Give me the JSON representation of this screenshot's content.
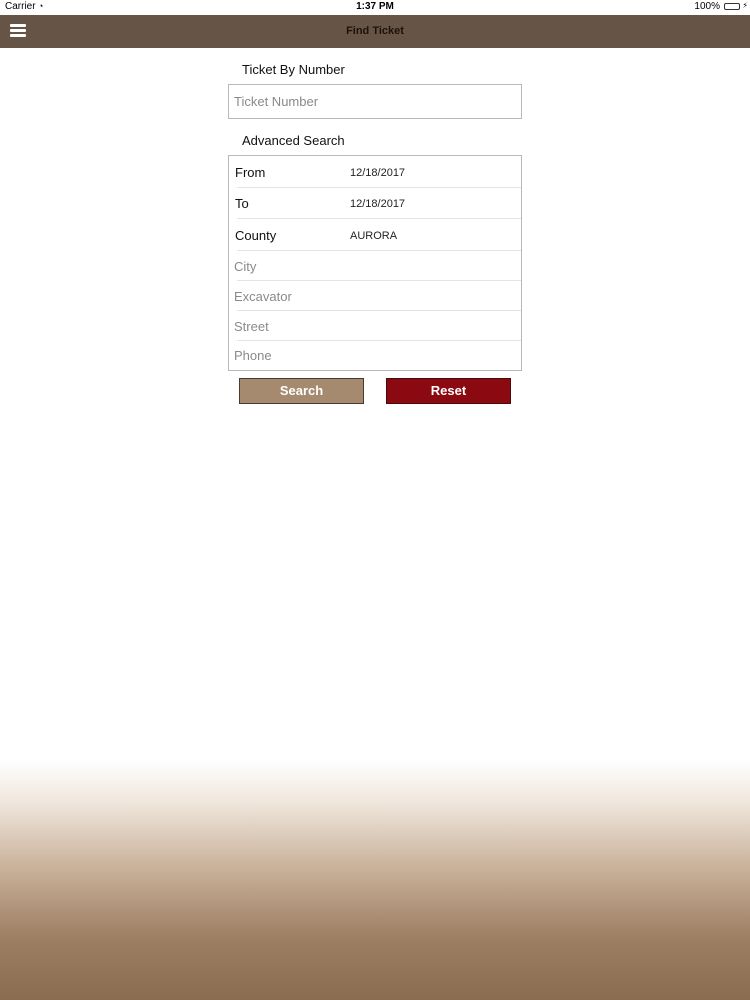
{
  "status_bar": {
    "carrier": "Carrier",
    "time": "1:37 PM",
    "battery": "100%"
  },
  "nav": {
    "title": "Find Ticket"
  },
  "ticket_by_number": {
    "heading": "Ticket By Number",
    "placeholder": "Ticket Number"
  },
  "advanced_search": {
    "heading": "Advanced Search",
    "from": {
      "label": "From",
      "value": "12/18/2017"
    },
    "to": {
      "label": "To",
      "value": "12/18/2017"
    },
    "county": {
      "label": "County",
      "value": "AURORA"
    },
    "city_placeholder": "City",
    "excavator_placeholder": "Excavator",
    "street_placeholder": "Street",
    "phone_placeholder": "Phone"
  },
  "buttons": {
    "search": "Search",
    "reset": "Reset"
  },
  "colors": {
    "nav_bar": "#665546",
    "search_button": "#a58a6f",
    "reset_button": "#8b0a11"
  }
}
